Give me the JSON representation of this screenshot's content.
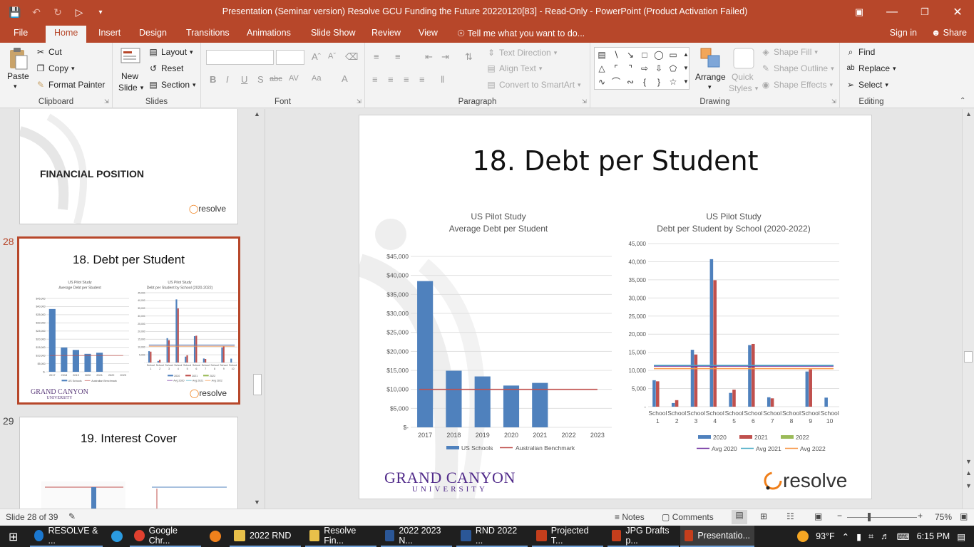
{
  "titlebar": {
    "title": "Presentation (Seminar version) Resolve GCU Funding the Future 20220120[83]  -  Read-Only - PowerPoint (Product Activation Failed)"
  },
  "tabs": [
    {
      "label": "File"
    },
    {
      "label": "Home"
    },
    {
      "label": "Insert"
    },
    {
      "label": "Design"
    },
    {
      "label": "Transitions"
    },
    {
      "label": "Animations"
    },
    {
      "label": "Slide Show"
    },
    {
      "label": "Review"
    },
    {
      "label": "View"
    }
  ],
  "tell_me": "Tell me what you want to do...",
  "account": {
    "signin": "Sign in",
    "share": "Share"
  },
  "ribbon": {
    "clipboard": {
      "label": "Clipboard",
      "paste": "Paste",
      "cut": "Cut",
      "copy": "Copy",
      "format_painter": "Format Painter"
    },
    "slides": {
      "label": "Slides",
      "new_slide_1": "New",
      "new_slide_2": "Slide",
      "layout": "Layout",
      "reset": "Reset",
      "section": "Section"
    },
    "font": {
      "label": "Font",
      "bold": "B",
      "italic": "I",
      "underline": "U",
      "strike": "S",
      "abc": "abc",
      "spacing": "AV",
      "case": "Aa"
    },
    "paragraph": {
      "label": "Paragraph",
      "text_direction": "Text Direction",
      "align_text": "Align Text",
      "smartart": "Convert to SmartArt"
    },
    "drawing": {
      "label": "Drawing",
      "arrange": "Arrange",
      "quick_1": "Quick",
      "quick_2": "Styles",
      "shape_fill": "Shape Fill",
      "shape_outline": "Shape Outline",
      "shape_effects": "Shape Effects"
    },
    "editing": {
      "label": "Editing",
      "find": "Find",
      "replace": "Replace",
      "select": "Select"
    }
  },
  "thumbnails": {
    "prev": {
      "title": "FINANCIAL POSITION",
      "logo": "resolve"
    },
    "current": {
      "number": "28",
      "title": "18. Debt per Student",
      "logo": "resolve",
      "gcu": "GRAND CANYON",
      "gcu_sub": "UNIVERSITY"
    },
    "next": {
      "number": "29",
      "title": "19. Interest Cover"
    }
  },
  "slide": {
    "title": "18. Debt per Student",
    "gcu_logo_1": "GRAND CANYON",
    "gcu_logo_2": "UNIVERSITY",
    "resolve_logo": "resolve"
  },
  "chart_data": [
    {
      "type": "bar",
      "title": "US Pilot Study",
      "subtitle": "Average Debt per Student",
      "categories": [
        "2017",
        "2018",
        "2019",
        "2020",
        "2021",
        "2022",
        "2023"
      ],
      "series": [
        {
          "name": "US Schools",
          "values": [
            38500,
            14900,
            13400,
            11000,
            11700,
            null,
            null
          ],
          "color": "#4f81bd"
        }
      ],
      "reference_line": {
        "name": "Australian Benchmark",
        "value": 10000,
        "color": "#c0504d"
      },
      "yticks": [
        "$-",
        "$5,000",
        "$10,000",
        "$15,000",
        "$20,000",
        "$25,000",
        "$30,000",
        "$35,000",
        "$40,000",
        "$45,000"
      ],
      "ylim": [
        0,
        45000
      ],
      "legend": "bottom",
      "grid": true
    },
    {
      "type": "bar",
      "title": "US Pilot Study",
      "subtitle": "Debt per Student by School (2020-2022)",
      "categories": [
        [
          "School",
          "1"
        ],
        [
          "School",
          "2"
        ],
        [
          "School",
          "3"
        ],
        [
          "School",
          "4"
        ],
        [
          "School",
          "5"
        ],
        [
          "School",
          "6"
        ],
        [
          "School",
          "7"
        ],
        [
          "School",
          "8"
        ],
        [
          "School",
          "9"
        ],
        [
          "School",
          "10"
        ]
      ],
      "series": [
        {
          "name": "2020",
          "values": [
            7300,
            1000,
            15700,
            40700,
            3800,
            17000,
            2600,
            0,
            9700,
            2500
          ],
          "color": "#4f81bd"
        },
        {
          "name": "2021",
          "values": [
            7000,
            1800,
            14400,
            34900,
            4700,
            17300,
            2300,
            0,
            10300,
            0
          ],
          "color": "#c0504d"
        },
        {
          "name": "2022",
          "values": [
            0,
            0,
            0,
            0,
            0,
            0,
            0,
            0,
            0,
            0
          ],
          "color": "#9bbb59"
        }
      ],
      "reference_lines": [
        {
          "name": "Avg 2020",
          "value": 11200,
          "color": "#7030a0"
        },
        {
          "name": "Avg 2021",
          "value": 11400,
          "color": "#4bacc6"
        },
        {
          "name": "Avg 2022",
          "value": 10500,
          "color": "#f79646"
        }
      ],
      "yticks": [
        "-",
        "5,000",
        "10,000",
        "15,000",
        "20,000",
        "25,000",
        "30,000",
        "35,000",
        "40,000",
        "45,000"
      ],
      "ylim": [
        0,
        45000
      ],
      "legend": "bottom",
      "grid": true
    }
  ],
  "statusbar": {
    "slide_info": "Slide 28 of 39",
    "notes": "Notes",
    "comments": "Comments",
    "zoom": "75%"
  },
  "taskbar": {
    "items": [
      "RESOLVE & ...",
      "Google Chr...",
      "2022 RND",
      "Resolve Fin...",
      "2022 2023 N...",
      "RND 2022 ...",
      "Projected T...",
      "JPG Drafts p...",
      "Presentatio..."
    ],
    "weather": "93°F",
    "time": "6:15 PM"
  }
}
